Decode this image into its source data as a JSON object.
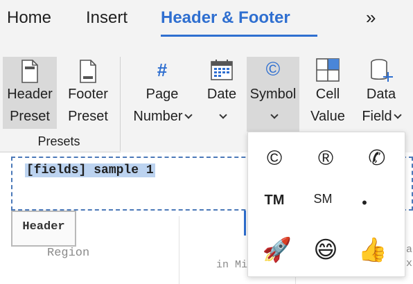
{
  "tabs": {
    "home": "Home",
    "insert": "Insert",
    "header_footer": "Header & Footer",
    "more": "»"
  },
  "ribbon": {
    "header_preset": {
      "line1": "Header",
      "line2": "Preset"
    },
    "footer_preset": {
      "line1": "Footer",
      "line2": "Preset"
    },
    "presets_group": "Presets",
    "page_number": {
      "icon": "#",
      "line1": "Page",
      "line2": "Number"
    },
    "date": {
      "line1": "Date"
    },
    "symbol": {
      "icon": "©",
      "line1": "Symbol"
    },
    "cell_value": {
      "line1": "Cell",
      "line2": "Value"
    },
    "data_field": {
      "line1": "Data",
      "line2": "Field"
    }
  },
  "document": {
    "field_text": "[fields] sample 1",
    "header_tag": "Header",
    "region_text": "Region",
    "cut_text_1": "in Mi",
    "cut_text_2": "al",
    "cut_text_3": "x"
  },
  "symbol_menu": {
    "items": [
      "©",
      "®",
      "✆",
      "TM",
      "SM",
      "•",
      "🚀",
      "😄",
      "👍"
    ]
  },
  "colors": {
    "accent": "#2f6fd0",
    "ribbon_bg": "#f3f3f3",
    "pressed_bg": "#d9d9d9",
    "selection": "#bcd3f0"
  }
}
